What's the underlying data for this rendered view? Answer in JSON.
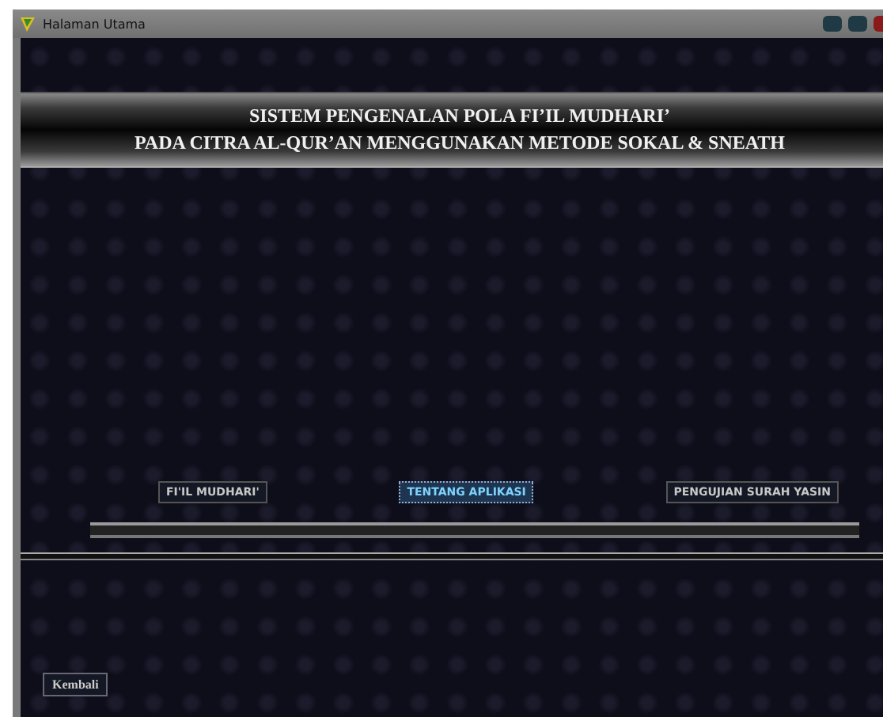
{
  "window": {
    "title": "Halaman Utama"
  },
  "banner": {
    "lines": [
      "SISTEM PENGENALAN POLA FI’IL MUDHARI’",
      "PADA CITRA AL-QUR’AN MENGGUNAKAN METODE SOKAL & SNEATH"
    ]
  },
  "menu_buttons": [
    {
      "label": "FI'IL MUDHARI'",
      "selected": false
    },
    {
      "label": "TENTANG APLIKASI",
      "selected": true
    },
    {
      "label": "PENGUJIAN SURAH YASIN",
      "selected": false
    }
  ],
  "back_button": {
    "label": "Kembali"
  }
}
